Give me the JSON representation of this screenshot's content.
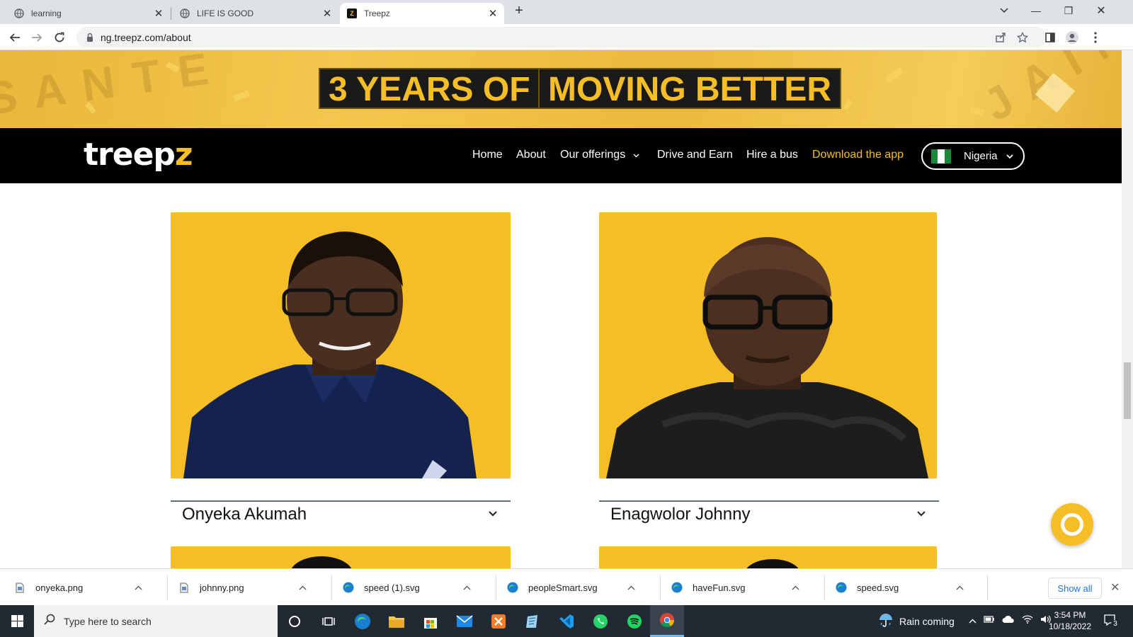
{
  "browser": {
    "tabs": [
      {
        "title": "learning",
        "active": false
      },
      {
        "title": "LIFE IS GOOD",
        "active": false
      },
      {
        "title": "Treepz",
        "active": true
      }
    ],
    "url": "ng.treepz.com/about"
  },
  "banner": {
    "part1": "3 YEARS OF",
    "part2": "MOVING BETTER"
  },
  "site": {
    "logo": "treep",
    "logo_z": "z",
    "nav": {
      "home": "Home",
      "about": "About",
      "offerings": "Our offerings",
      "drive": "Drive and Earn",
      "hire": "Hire a bus",
      "download": "Download the app"
    },
    "country": "Nigeria"
  },
  "team": [
    {
      "name": "Onyeka Akumah"
    },
    {
      "name": "Enagwolor Johnny"
    }
  ],
  "downloads": {
    "items": [
      "onyeka.png",
      "johnny.png",
      "speed (1).svg",
      "peopleSmart.svg",
      "haveFun.svg",
      "speed.svg"
    ],
    "show_all": "Show all"
  },
  "taskbar": {
    "search_placeholder": "Type here to search",
    "weather": "Rain coming",
    "time": "3:54 PM",
    "date": "10/18/2022",
    "notifications": "3"
  },
  "colors": {
    "brand_yellow": "#f5bd26",
    "nav_black": "#000000"
  }
}
